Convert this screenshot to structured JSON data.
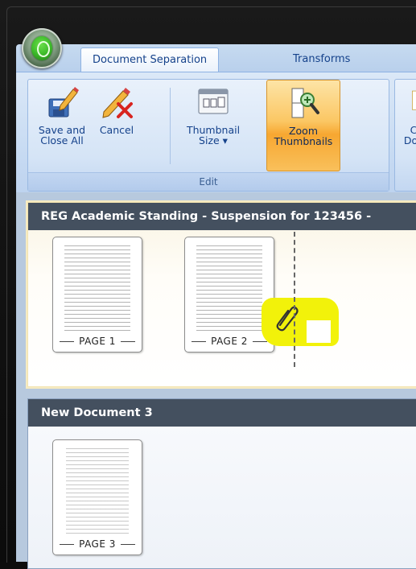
{
  "ribbon": {
    "tabs": [
      {
        "label": "Document Separation",
        "active": true
      },
      {
        "label": "Transforms",
        "active": false
      }
    ],
    "buttons": {
      "save_close": "Save and\nClose All",
      "cancel": "Cancel",
      "thumbnail_size": "Thumbnail\nSize ▾",
      "zoom_thumbnails": "Zoom\nThumbnails",
      "partial": "C\nDoc"
    },
    "group_label": "Edit"
  },
  "documents": [
    {
      "title": "REG Academic Standing - Suspension for 123456 -",
      "pages": [
        "PAGE 1",
        "PAGE 2"
      ]
    },
    {
      "title": "New Document 3",
      "pages": [
        "PAGE 3"
      ]
    }
  ],
  "colors": {
    "ribbon_text": "#15428b",
    "active_button": "#fbc764",
    "doc_header": "#44505f",
    "highlight": "#f2f20a"
  },
  "icons": {
    "save_close": "floppy-pencil-icon",
    "cancel": "pencil-x-icon",
    "thumbnail_size": "thumbnail-window-icon",
    "zoom_thumbnails": "zoom-pages-icon",
    "split": "paperclip-icon"
  }
}
